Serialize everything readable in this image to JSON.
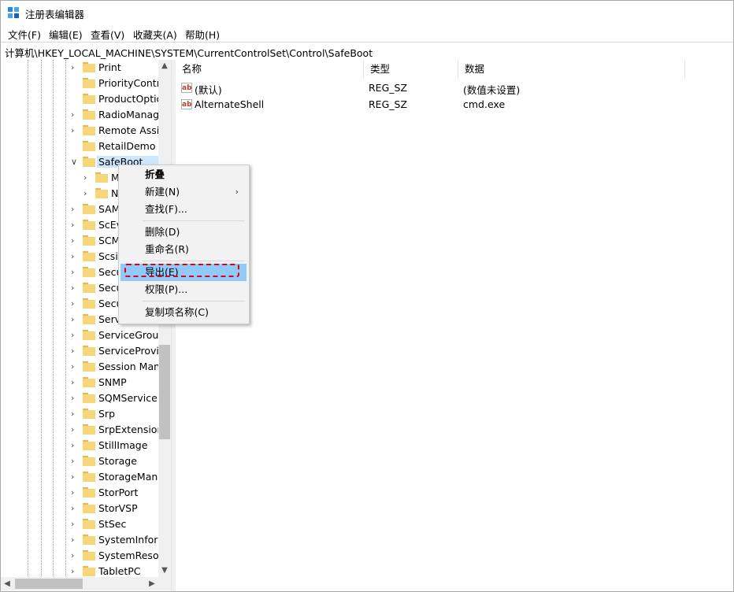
{
  "window": {
    "title": "注册表编辑器"
  },
  "menu": [
    "文件(F)",
    "编辑(E)",
    "查看(V)",
    "收藏夹(A)",
    "帮助(H)"
  ],
  "address": "计算机\\HKEY_LOCAL_MACHINE\\SYSTEM\\CurrentControlSet\\Control\\SafeBoot",
  "tree": {
    "items": [
      {
        "label": "Print",
        "expand": ">"
      },
      {
        "label": "PriorityContro",
        "expand": ""
      },
      {
        "label": "ProductOptio",
        "expand": ""
      },
      {
        "label": "RadioManag",
        "expand": ">"
      },
      {
        "label": "Remote Assis",
        "expand": ">"
      },
      {
        "label": "RetailDemo",
        "expand": ""
      },
      {
        "label": "SafeBoot",
        "expand": "v"
      },
      {
        "label": "M",
        "expand": ">"
      },
      {
        "label": "N",
        "expand": ">"
      },
      {
        "label": "SAM",
        "expand": ">"
      },
      {
        "label": "ScEv",
        "expand": ">"
      },
      {
        "label": "SCM",
        "expand": ">"
      },
      {
        "label": "Scsil",
        "expand": ">"
      },
      {
        "label": "Secu",
        "expand": ">"
      },
      {
        "label": "Secu",
        "expand": ">"
      },
      {
        "label": "Secu",
        "expand": ">"
      },
      {
        "label": "Serv",
        "expand": ">"
      },
      {
        "label": "ServiceGroup",
        "expand": ">"
      },
      {
        "label": "ServiceProvic",
        "expand": ">"
      },
      {
        "label": "Session Mana",
        "expand": ">"
      },
      {
        "label": "SNMP",
        "expand": ">"
      },
      {
        "label": "SQMServiceL",
        "expand": ">"
      },
      {
        "label": "Srp",
        "expand": ">"
      },
      {
        "label": "SrpExtension",
        "expand": ">"
      },
      {
        "label": "StillImage",
        "expand": ">"
      },
      {
        "label": "Storage",
        "expand": ">"
      },
      {
        "label": "StorageMana",
        "expand": ">"
      },
      {
        "label": "StorPort",
        "expand": ">"
      },
      {
        "label": "StorVSP",
        "expand": ">"
      },
      {
        "label": "StSec",
        "expand": ">"
      },
      {
        "label": "SystemInform",
        "expand": ">"
      },
      {
        "label": "SystemResou",
        "expand": ">"
      },
      {
        "label": "TabletPC",
        "expand": ">"
      }
    ]
  },
  "list": {
    "columns": [
      "名称",
      "类型",
      "数据"
    ],
    "rows": [
      {
        "name": "(默认)",
        "type": "REG_SZ",
        "data": "(数值未设置)"
      },
      {
        "name": "AlternateShell",
        "type": "REG_SZ",
        "data": "cmd.exe"
      }
    ],
    "icon_text": "ab"
  },
  "context_menu": {
    "collapse": "折叠",
    "new": "新建(N)",
    "find": "查找(F)...",
    "delete": "删除(D)",
    "rename": "重命名(R)",
    "export": "导出(E)",
    "permissions": "权限(P)...",
    "copy_key_name": "复制项名称(C)"
  },
  "colors": {
    "folder": "#f7d67a",
    "selection": "#cce8ff",
    "highlight": "#91c9f7",
    "annotation": "#e0001b"
  }
}
